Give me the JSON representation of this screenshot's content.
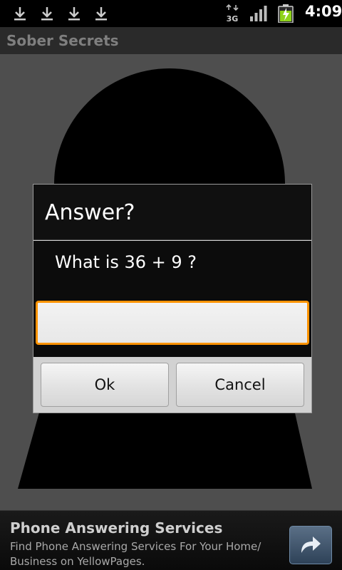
{
  "status_bar": {
    "time": "4:09",
    "network": "3G",
    "icons": [
      "download-icon",
      "download-icon",
      "download-icon",
      "download-icon",
      "network-3g-icon",
      "signal-icon",
      "battery-charging-icon"
    ]
  },
  "app": {
    "title": "Sober Secrets"
  },
  "dialog": {
    "title": "Answer?",
    "message": "What is 36 + 9 ?",
    "input_value": "",
    "ok_label": "Ok",
    "cancel_label": "Cancel",
    "accent_color": "#ff9300"
  },
  "ad": {
    "title": "Phone Answering Services",
    "text": "Find Phone Answering Services For Your Home/ Business on YellowPages.",
    "go_icon": "arrow-forward-icon"
  }
}
